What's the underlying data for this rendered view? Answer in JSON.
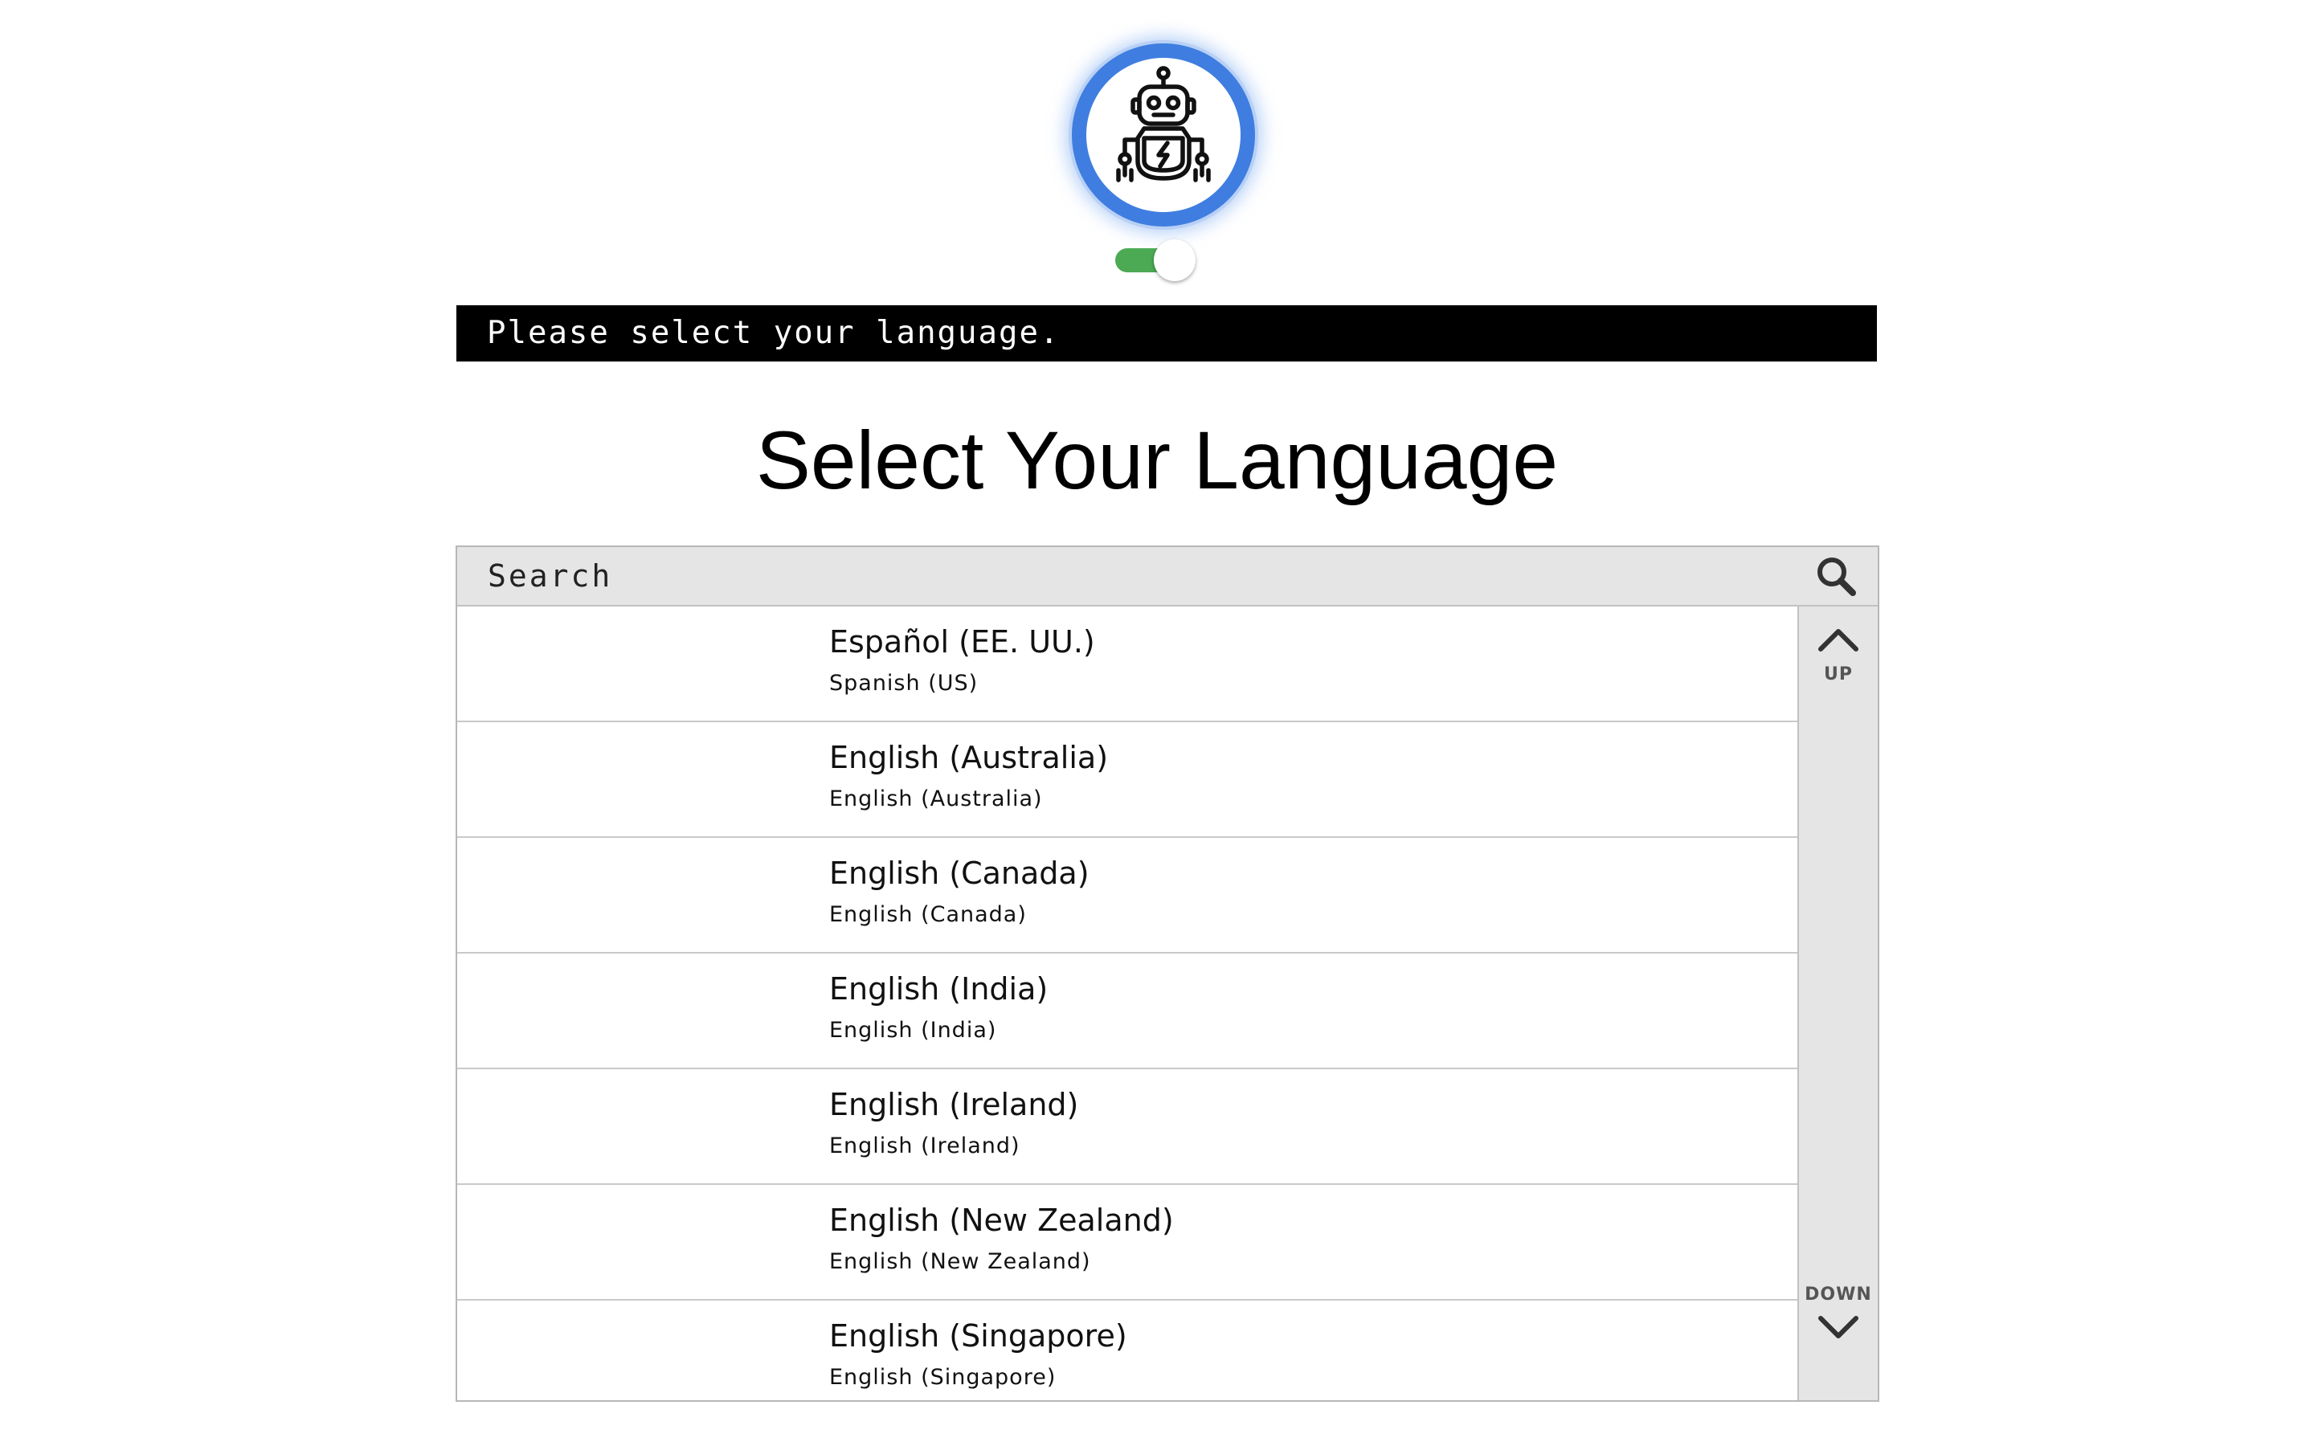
{
  "status_message": "Please select your language.",
  "page_title": "Select Your Language",
  "search": {
    "placeholder": "Search",
    "value": ""
  },
  "avatar": {
    "icon": "robot-icon",
    "ring_color": "#3f7ee0"
  },
  "toggle": {
    "state": "on",
    "color": "#4caa55"
  },
  "languages": [
    {
      "native": "Español (EE. UU.)",
      "english": "Spanish (US)"
    },
    {
      "native": "English (Australia)",
      "english": "English (Australia)"
    },
    {
      "native": "English (Canada)",
      "english": "English (Canada)"
    },
    {
      "native": "English (India)",
      "english": "English (India)"
    },
    {
      "native": "English (Ireland)",
      "english": "English (Ireland)"
    },
    {
      "native": "English (New Zealand)",
      "english": "English (New Zealand)"
    },
    {
      "native": "English (Singapore)",
      "english": "English (Singapore)"
    }
  ],
  "scroll": {
    "up_label": "UP",
    "down_label": "DOWN"
  }
}
